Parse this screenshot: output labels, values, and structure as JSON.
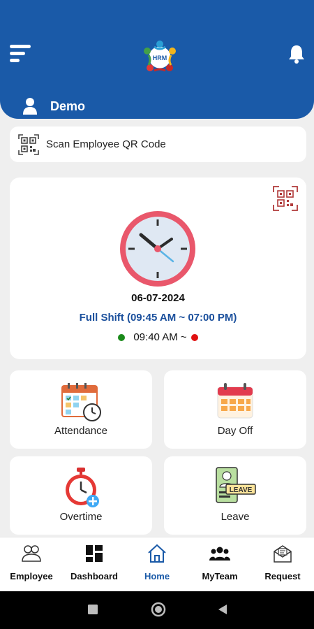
{
  "header": {
    "user_name": "Demo",
    "logo_text": "HRM",
    "menu_icon": "hamburger-menu-icon",
    "notification_icon": "bell-icon"
  },
  "scan": {
    "label": "Scan Employee QR Code",
    "icon": "qr-code-icon"
  },
  "attendance_card": {
    "date": "06-07-2024",
    "shift": "Full Shift (09:45 AM ~ 07:00 PM)",
    "check_in": "09:40 AM ~",
    "check_in_status_color": "#1a8a1a",
    "check_out_status_color": "#e01010"
  },
  "tiles": [
    {
      "label": "Attendance",
      "icon": "attendance-calendar-icon"
    },
    {
      "label": "Day Off",
      "icon": "day-off-calendar-icon"
    },
    {
      "label": "Overtime",
      "icon": "overtime-stopwatch-icon"
    },
    {
      "label": "Leave",
      "icon": "leave-icon",
      "badge_text": "LEAVE"
    }
  ],
  "bottom_nav": [
    {
      "label": "Employee",
      "icon": "employee-icon",
      "active": false
    },
    {
      "label": "Dashboard",
      "icon": "dashboard-icon",
      "active": false
    },
    {
      "label": "Home",
      "icon": "home-icon",
      "active": true
    },
    {
      "label": "MyTeam",
      "icon": "team-icon",
      "active": false
    },
    {
      "label": "Request",
      "icon": "request-envelope-icon",
      "active": false
    }
  ],
  "colors": {
    "brand_blue": "#1a5aa8",
    "shift_text": "#1a4f9c",
    "background": "#efefef"
  }
}
